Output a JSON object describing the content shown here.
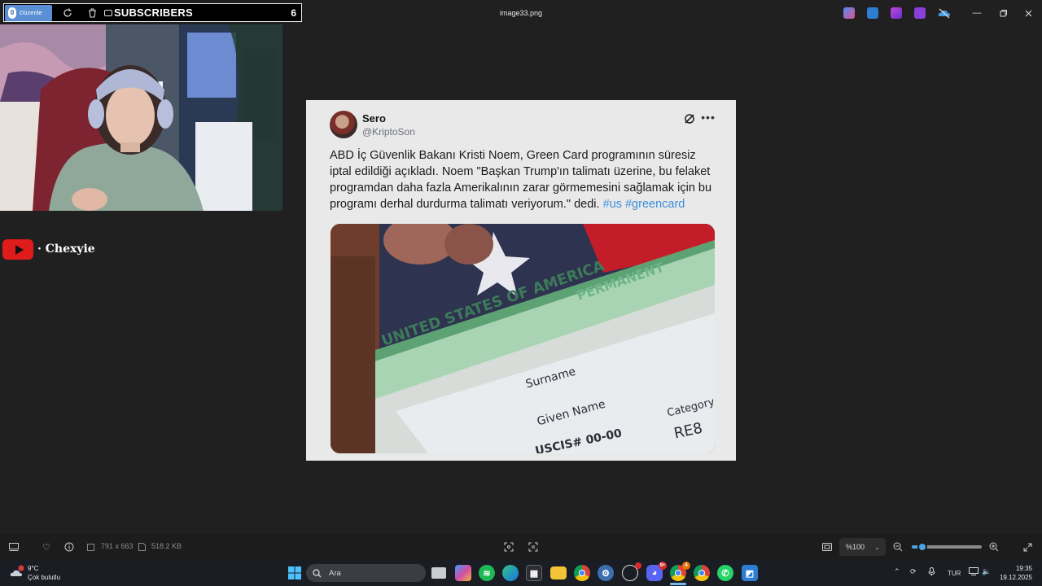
{
  "window": {
    "title": "image33.png"
  },
  "stream_overlay": {
    "edit_button": "Düzenle",
    "subscribers_label": "SUBSCRIBERS",
    "subscribers_count": "6",
    "channel_name": "· Chexyie"
  },
  "tweet": {
    "author": "Sero",
    "handle": "@KriptoSon",
    "text": "ABD İç Güvenlik Bakanı Kristi Noem, Green Card programının süresiz iptal edildiği açıkladı. Noem \"Başkan Trump'ın talimatı üzerine, bu felaket programdan daha fazla Amerikalının zarar görmemesini sağlamak için bu programı derhal durdurma talimatı veriyorum.\" dedi.",
    "hashtags": "#us #greencard",
    "image_card": {
      "header": "UNITED STATES OF AMERICA",
      "header2": "PERMANENT",
      "field1": "Surname",
      "field2": "Given Name",
      "field3": "Category",
      "category_value": "RE8",
      "bottom": "USCIS#  00-00"
    }
  },
  "viewer": {
    "dimensions": "791 x 663",
    "file_size": "518.2 KB",
    "zoom_label": "%100",
    "zoom_level": 0.15
  },
  "taskbar": {
    "weather_temp": "9°C",
    "weather_desc": "Çok bulutlu",
    "search_placeholder": "Ara",
    "language": "TUR",
    "time": "19:35",
    "date": "19.12.2025",
    "badges": {
      "discord": "9+",
      "chrome": "4"
    }
  },
  "colors": {
    "accent": "#4aa3e0",
    "youtube": "#e01b1b",
    "hashtag": "#3b8fdc"
  }
}
